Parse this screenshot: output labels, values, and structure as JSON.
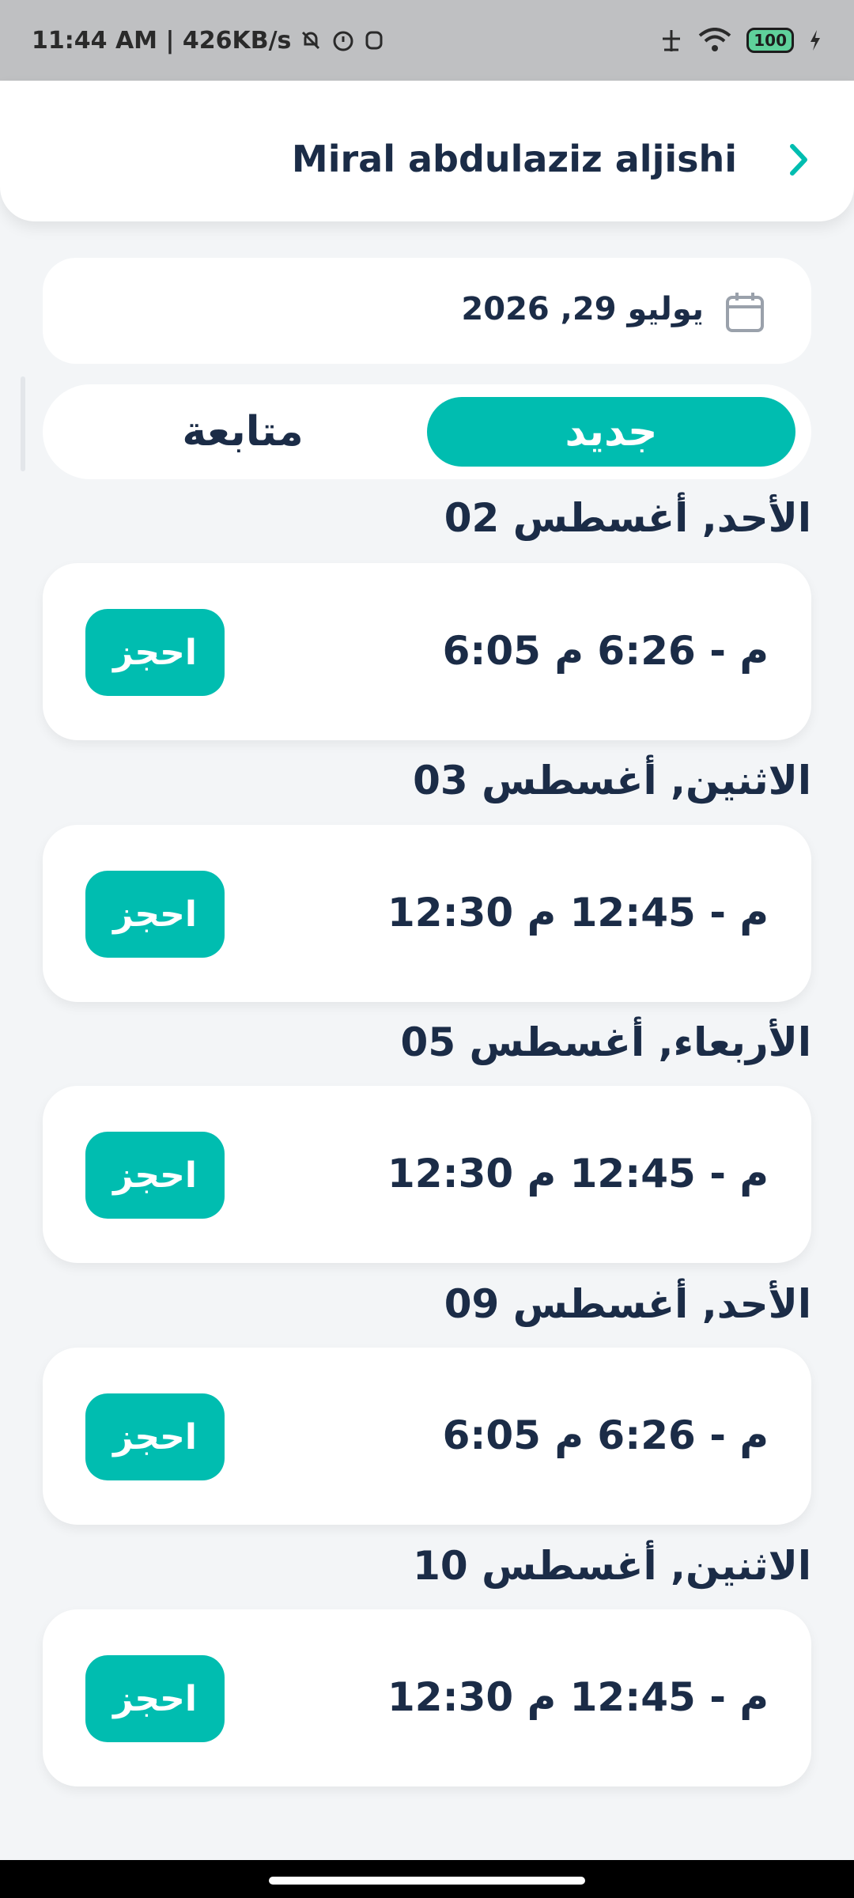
{
  "status_bar": {
    "time_speed": "11:44 AM | 426KB/s",
    "battery": "100",
    "icons": [
      "mute-bell-icon",
      "alarm-icon",
      "app-icon",
      "signal-icon",
      "wifi-icon",
      "battery-icon",
      "charging-icon"
    ]
  },
  "header": {
    "title": "Miral abdulaziz aljishi",
    "back_icon": "chevron-right-icon"
  },
  "date_picker": {
    "value": "يوليو 29, 2026",
    "icon": "calendar-icon"
  },
  "tabs": [
    {
      "label": "جديد",
      "selected": true
    },
    {
      "label": "متابعة",
      "selected": false
    }
  ],
  "schedule": [
    {
      "day": "الأحد, أغسطس 02",
      "time": "6:05 م - 6:26 م",
      "action": "احجز"
    },
    {
      "day": "الاثنين, أغسطس 03",
      "time": "12:30 م - 12:45 م",
      "action": "احجز"
    },
    {
      "day": "الأربعاء, أغسطس 05",
      "time": "12:30 م - 12:45 م",
      "action": "احجز"
    },
    {
      "day": "الأحد, أغسطس 09",
      "time": "6:05 م - 6:26 م",
      "action": "احجز"
    },
    {
      "day": "الاثنين, أغسطس 10",
      "time": "12:30 م - 12:45 م",
      "action": "احجز"
    }
  ],
  "colors": {
    "accent": "#00bdb0",
    "text": "#1b2c47",
    "background": "#f3f5f7"
  }
}
